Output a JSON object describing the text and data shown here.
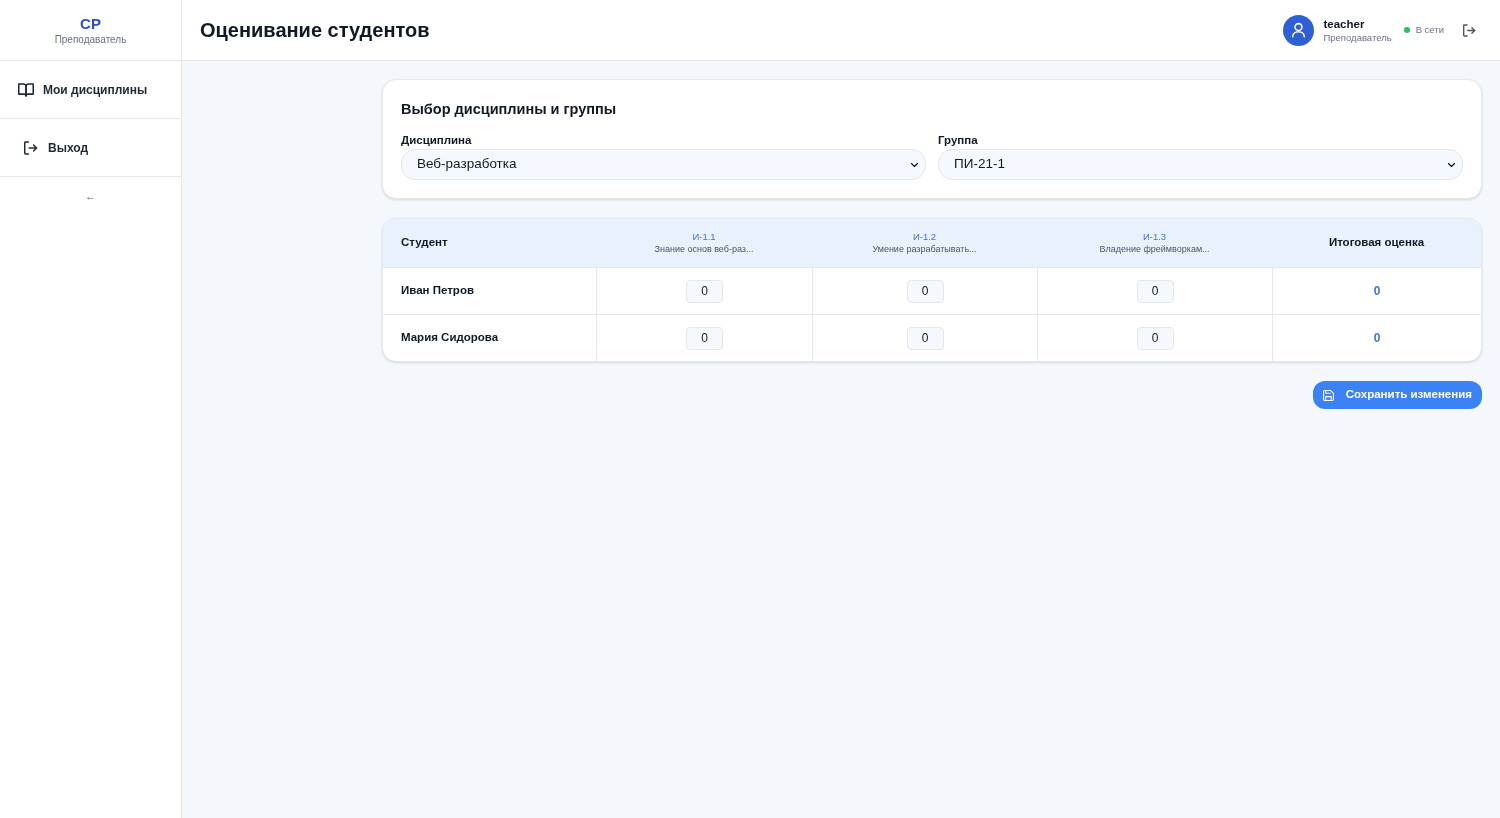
{
  "sidebar": {
    "logo": "СР",
    "role": "Преподаватель",
    "items": [
      {
        "kind": "disciplines",
        "label": "Мои дисциплины",
        "selected": false
      },
      {
        "kind": "logout",
        "label": "Выход",
        "selected": false
      }
    ],
    "collapse": "←"
  },
  "header": {
    "title": "Оценивание студентов",
    "user": {
      "name": "teacher",
      "role": "Преподаватель",
      "online": true,
      "status": "В сети"
    }
  },
  "selection": {
    "title": "Выбор дисциплины и группы",
    "fields": [
      {
        "label": "Дисциплина",
        "value": "Веб-разработка"
      },
      {
        "label": "Группа",
        "value": "ПИ-21-1"
      }
    ]
  },
  "table": {
    "columns": [
      {
        "kind": "student",
        "label": "Студент"
      },
      {
        "kind": "indicator",
        "code": "И-1.1",
        "description": "Знание основ веб-раз..."
      },
      {
        "kind": "indicator",
        "code": "И-1.2",
        "description": "Умение разрабатывать..."
      },
      {
        "kind": "indicator",
        "code": "И-1.3",
        "description": "Владение фреймворкам..."
      },
      {
        "kind": "total",
        "label": "Итоговая оценка"
      }
    ],
    "rows": [
      {
        "name": "Иван Петров",
        "scores": [
          "0",
          "0",
          "0"
        ],
        "total": "0"
      },
      {
        "name": "Мария Сидорова",
        "scores": [
          "0",
          "0",
          "0"
        ],
        "total": "0"
      }
    ]
  },
  "save_button": {
    "label": "Сохранить изменения"
  }
}
